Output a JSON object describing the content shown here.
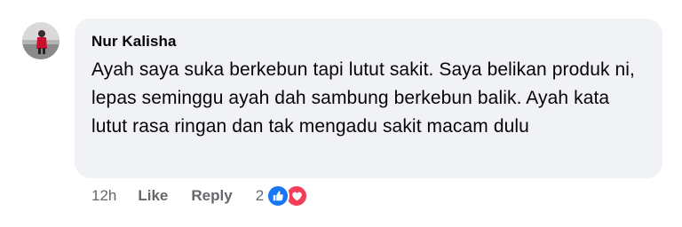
{
  "comment": {
    "author": "Nur Kalisha",
    "text": "Ayah saya suka berkebun tapi lutut sakit. Saya belikan produk ni, lepas seminggu ayah dah sambung berkebun balik. Ayah kata lutut rasa ringan dan tak mengadu sakit macam dulu",
    "timestamp": "12h",
    "like_label": "Like",
    "reply_label": "Reply",
    "reaction_count": "2",
    "reactions": [
      "like-icon",
      "love-icon"
    ]
  },
  "colors": {
    "bubble_bg": "#f0f2f5",
    "meta_text": "#65676b",
    "like_blue": "#1877f2",
    "love_red": "#f33e58"
  }
}
